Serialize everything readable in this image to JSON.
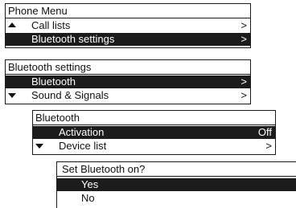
{
  "phone_menu": {
    "title": "Phone Menu",
    "items": [
      {
        "label": "Call lists",
        "value": ">",
        "selected": false,
        "icon": "up-arrow-icon"
      },
      {
        "label": "Bluetooth settings",
        "value": ">",
        "selected": true
      }
    ]
  },
  "bt_settings": {
    "title": "Bluetooth settings",
    "items": [
      {
        "label": "Bluetooth",
        "value": ">",
        "selected": true
      },
      {
        "label": "Sound & Signals",
        "value": ">",
        "selected": false,
        "icon": "down-arrow-icon"
      }
    ]
  },
  "bluetooth": {
    "title": "Bluetooth",
    "items": [
      {
        "label": "Activation",
        "value": "Off",
        "selected": true
      },
      {
        "label": "Device list",
        "value": ">",
        "selected": false,
        "icon": "down-arrow-icon"
      }
    ]
  },
  "confirm": {
    "title": "Set Bluetooth on?",
    "items": [
      {
        "label": "Yes",
        "selected": true
      },
      {
        "label": "No",
        "selected": false
      }
    ]
  }
}
